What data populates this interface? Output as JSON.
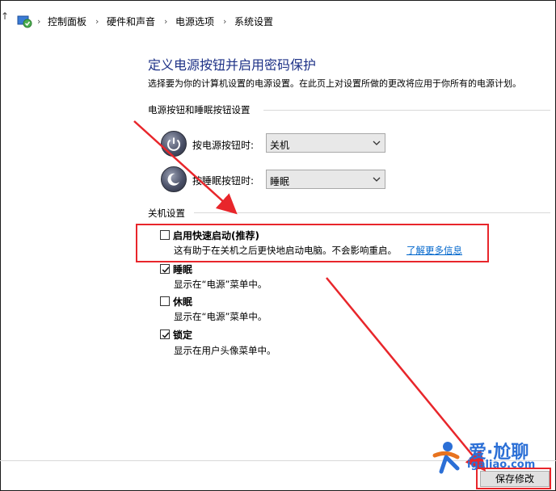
{
  "breadcrumb": {
    "items": [
      "控制面板",
      "硬件和声音",
      "电源选项",
      "系统设置"
    ],
    "separator": "›",
    "icon": "control-panel-icon",
    "up_arrow": "↑"
  },
  "header": {
    "title": "定义电源按钮并启用密码保护",
    "description": "选择要为你的计算机设置的电源设置。在此页上对设置所做的更改将应用于你所有的电源计划。"
  },
  "power_buttons": {
    "section_title": "电源按钮和睡眠按钮设置",
    "power_button": {
      "label": "按电源按钮时:",
      "value": "关机",
      "icon": "power-icon"
    },
    "sleep_button": {
      "label": "按睡眠按钮时:",
      "value": "睡眠",
      "icon": "sleep-icon"
    }
  },
  "shutdown": {
    "section_title": "关机设置",
    "options": [
      {
        "label": "启用快速启动(推荐)",
        "description": "这有助于在关机之后更快地启动电脑。不会影响重启。",
        "link": "了解更多信息",
        "checked": false
      },
      {
        "label": "睡眠",
        "description": "显示在“电源”菜单中。",
        "checked": true
      },
      {
        "label": "休眠",
        "description": "显示在“电源”菜单中。",
        "checked": false
      },
      {
        "label": "锁定",
        "description": "显示在用户头像菜单中。",
        "checked": true
      }
    ]
  },
  "footer": {
    "save_label": "保存修改"
  },
  "watermark": {
    "brand": "爱·尬聊",
    "site": "igaliao.com"
  },
  "colors": {
    "title": "#1e3287",
    "link": "#0066cc",
    "annotation_red": "#e8262b"
  }
}
